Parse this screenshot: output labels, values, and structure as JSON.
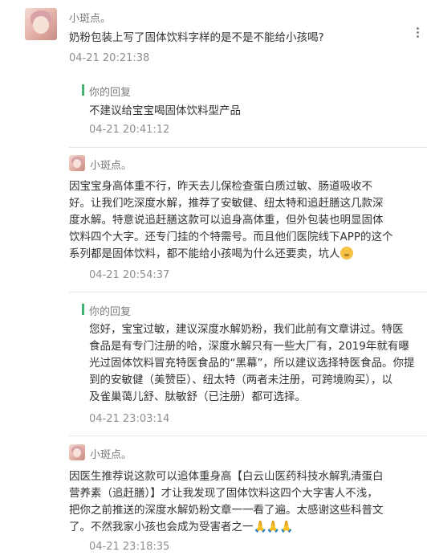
{
  "messages": [
    {
      "user": "小斑点。",
      "text": "奶粉包装上写了固体饮料字样的是不是不能给小孩喝?",
      "time": "04-21 20:21:38"
    },
    {
      "reply_label": "你的回复",
      "text": "不建议给宝宝喝固体饮料型产品",
      "time": "04-21 20:41:12"
    },
    {
      "user": "小斑点。",
      "lines": [
        "因宝宝身高体重不行，昨天去儿保检查蛋白质过敏、肠道吸收不",
        "好。让我们吃深度水解，推荐了安敏健、纽太特和追赶膳这几款深",
        "度水解。特意说追赶膳这款可以追身高体重，但外包装也明显固体",
        "饮料四个大字。还专门挂的个特需号。而且他们医院线下APP的这个",
        "系列都是固体饮料，都不能给小孩喝为什么还要卖，坑人"
      ],
      "emoji": "sad-face-emoji",
      "time": "04-21 20:54:37"
    },
    {
      "reply_label": "你的回复",
      "lines": [
        "您好，宝宝过敏，建议深度水解奶粉，我们此前有文章讲过。特医",
        "食品是有专门注册的哈，深度水解只有一些大厂有，2019年就有曝",
        "光过固体饮料冒充特医食品的“黑幕”，所以建议选择特医食品。你提",
        "到的安敏健（美赞臣）、纽太特（两者未注册，可跨境购买），以",
        "及雀巢蔼儿舒、肽敏舒（已注册）都可选择。"
      ],
      "time": "04-21 23:03:14"
    },
    {
      "user": "小斑点。",
      "lines": [
        "因医生推荐说这款可以追体重身高【白云山医药科技水解乳清蛋白",
        "营养素（追赶膳）】才让我发现了固体饮料这四个大字害人不浅，",
        "把你之前推送的深度水解奶粉文章一一看了遍。太感谢这些科普文",
        "了。不然我家小孩也会成为受害者之一"
      ],
      "emoji": "folded-hands-emoji",
      "time": "04-21 23:18:35"
    }
  ]
}
